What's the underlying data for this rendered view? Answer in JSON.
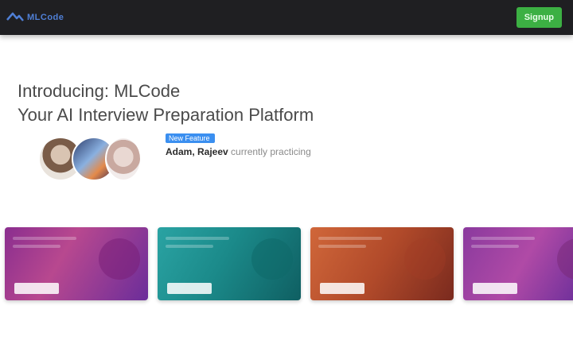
{
  "header": {
    "logo_text": "MLCode",
    "cta_label": "Signup"
  },
  "hero": {
    "line1": "Introducing: MLCode",
    "line2": "Your AI Interview Preparation Platform"
  },
  "social_proof": {
    "badge": "New Feature",
    "names": "Adam, Rajeev",
    "suffix": " currently practicing"
  },
  "cards": [
    {
      "name": "card-purple",
      "accent": "#8a2e8f"
    },
    {
      "name": "card-teal",
      "accent": "#1b8a8a"
    },
    {
      "name": "card-orange",
      "accent": "#b14a2a"
    },
    {
      "name": "card-violet",
      "accent": "#8a3a9e"
    }
  ],
  "colors": {
    "topbar": "#1f1f22",
    "cta": "#3cb043",
    "badge": "#3b8ff0"
  }
}
